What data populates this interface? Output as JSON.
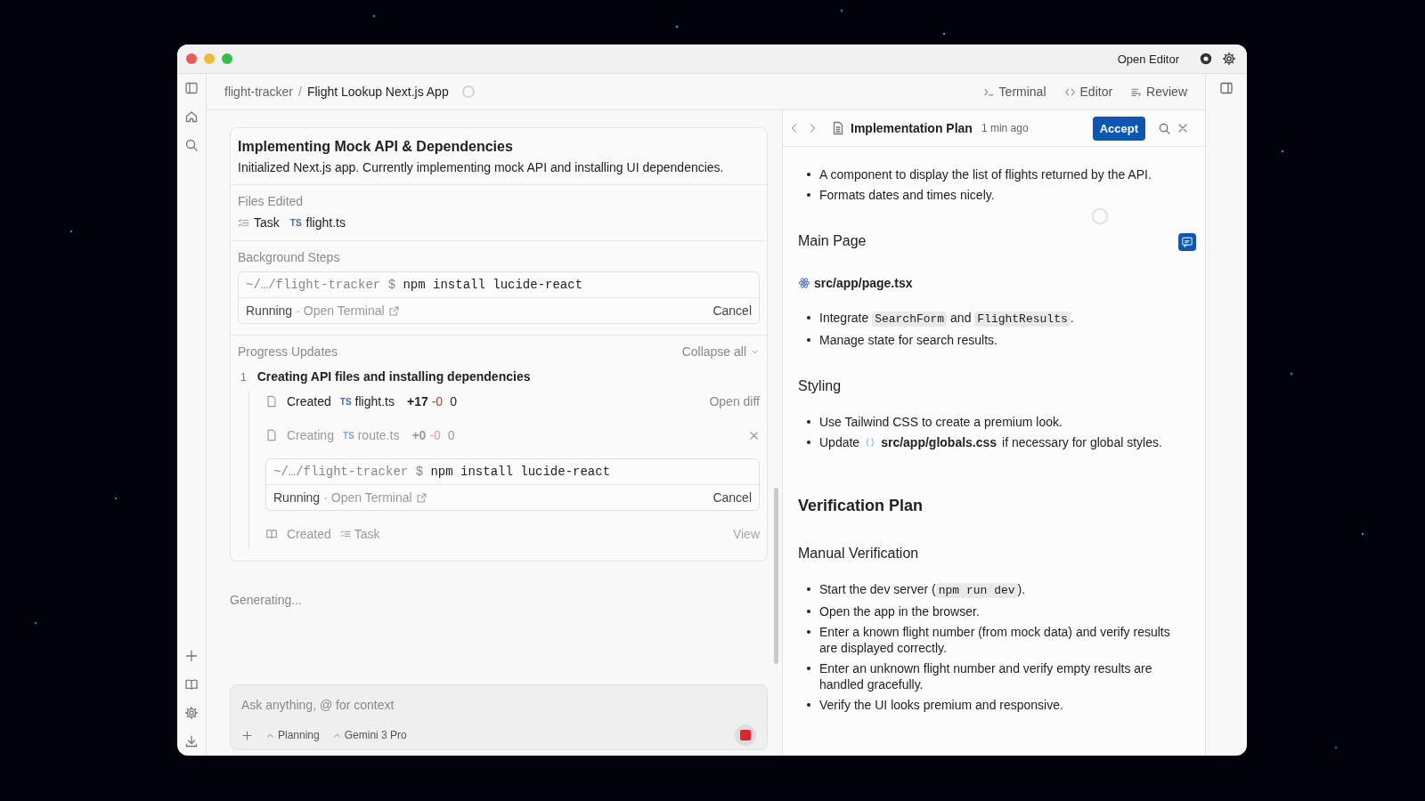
{
  "title_bar": {
    "open_editor": "Open Editor"
  },
  "breadcrumb": {
    "project": "flight-tracker",
    "separator": "/",
    "title": "Flight Lookup Next.js App"
  },
  "view_tabs": [
    {
      "label": "Terminal",
      "kind": "terminal"
    },
    {
      "label": "Editor",
      "kind": "editor"
    },
    {
      "label": "Review",
      "kind": "review"
    }
  ],
  "task_card": {
    "title": "Implementing Mock API & Dependencies",
    "summary": "Initialized Next.js app. Currently implementing mock API and installing UI dependencies.",
    "files_edited": {
      "heading": "Files Edited",
      "files": [
        {
          "kind": "task",
          "label": "Task"
        },
        {
          "kind": "ts",
          "badge": "TS",
          "label": "flight.ts"
        }
      ]
    },
    "background_steps": {
      "heading": "Background Steps",
      "terminals": [
        {
          "path": "~/…/flight-tracker $",
          "command": "npm install lucide-react",
          "status": "Running",
          "separator": "·",
          "link": "Open Terminal",
          "action": "Cancel"
        }
      ]
    },
    "progress": {
      "heading": "Progress Updates",
      "collapse": "Collapse all",
      "steps": [
        {
          "number": "1",
          "title": "Creating API files and installing dependencies",
          "items": [
            {
              "kind": "file",
              "dimmed": false,
              "verb": "Created",
              "badge": "TS",
              "file": "flight.ts",
              "added": "+17",
              "removed": "-0",
              "count": "0",
              "action": "Open diff"
            },
            {
              "kind": "file",
              "dimmed": true,
              "verb": "Creating",
              "badge": "TS",
              "file": "route.ts",
              "added": "+0",
              "removed": "-0",
              "count": "0"
            },
            {
              "kind": "terminal",
              "path": "~/…/flight-tracker $",
              "command": "npm install lucide-react",
              "status": "Running",
              "separator": "·",
              "link": "Open Terminal",
              "action": "Cancel"
            },
            {
              "kind": "task",
              "dimmed": true,
              "verb": "Created",
              "file": "Task",
              "action": "View"
            }
          ]
        }
      ]
    }
  },
  "generating": "Generating...",
  "composer": {
    "placeholder": "Ask anything, @ for context",
    "mode": "Planning",
    "model": "Gemini 3 Pro"
  },
  "doc": {
    "title": "Implementation Plan",
    "time": "1 min ago",
    "accept": "Accept",
    "blocks": [
      {
        "kind": "bullets",
        "items": [
          [
            "A component to display the list of flights returned by the API."
          ],
          [
            "Formats dates and times nicely."
          ]
        ]
      },
      {
        "kind": "h3",
        "text": "Main Page"
      },
      {
        "kind": "file",
        "text": "src/app/page.tsx"
      },
      {
        "kind": "bullets",
        "items": [
          [
            "Integrate ",
            {
              "code": "SearchForm"
            },
            " and ",
            {
              "code": "FlightResults"
            },
            "."
          ],
          [
            "Manage state for search results."
          ]
        ]
      },
      {
        "kind": "h3",
        "text": "Styling"
      },
      {
        "kind": "bullets",
        "items": [
          [
            "Use Tailwind CSS to create a premium look."
          ],
          [
            "Update",
            {
              "file": "src/app/globals.css"
            },
            "if necessary for global styles."
          ]
        ]
      },
      {
        "kind": "h2",
        "text": "Verification Plan"
      },
      {
        "kind": "h3",
        "text": "Manual Verification"
      },
      {
        "kind": "bullets",
        "items": [
          [
            "Start the dev server (",
            {
              "code": "npm run dev"
            },
            ")."
          ],
          [
            "Open the app in the browser."
          ],
          [
            "Enter a known flight number (from mock data) and verify results are displayed correctly."
          ],
          [
            "Enter an unknown flight number and verify empty results are handled gracefully."
          ],
          [
            "Verify the UI looks premium and responsive."
          ]
        ]
      }
    ]
  }
}
